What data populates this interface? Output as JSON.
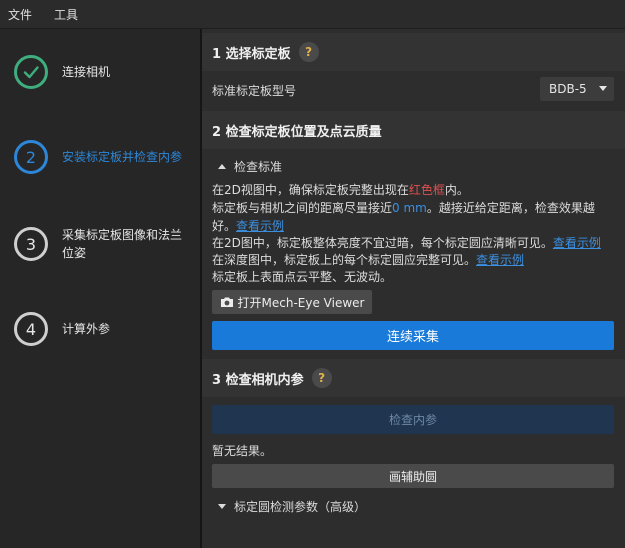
{
  "menu": {
    "file": "文件",
    "tools": "工具"
  },
  "steps": [
    {
      "label": "连接相机",
      "state": "done"
    },
    {
      "number": "2",
      "label": "安装标定板并检查内参",
      "state": "active"
    },
    {
      "number": "3",
      "label": "采集标定板图像和法兰位姿",
      "state": "pending"
    },
    {
      "number": "4",
      "label": "计算外参",
      "state": "pending"
    }
  ],
  "section1": {
    "title": "1 选择标定板",
    "help": "?",
    "board_label": "标准标定板型号",
    "board_value": "BDB-5"
  },
  "section2": {
    "title": "2 检查标定板位置及点云质量",
    "criteria_toggle": "检查标准",
    "line1_a": "在2D视图中，确保标定板完整出现在",
    "line1_red": "红色框",
    "line1_b": "内。",
    "line2_a": "标定板与相机之间的距离尽量接近",
    "line2_blue": "0 mm",
    "line2_b": "。越接近给定距离，检查效果越",
    "line3_a": "好。",
    "line3_link": "查看示例",
    "line4_a": "在2D图中，标定板整体亮度不宜过暗，每个标定圆应清晰可见。",
    "line4_link": "查看示例",
    "line5_a": "在深度图中，标定板上的每个标定圆应完整可见。",
    "line5_link": "查看示例",
    "line6": "标定板上表面点云平整、无波动。",
    "open_viewer": "打开Mech-Eye Viewer",
    "continuous_capture": "连续采集"
  },
  "section3": {
    "title": "3 检查相机内参",
    "help": "?",
    "check_button": "检查内参",
    "result": "暂无结果。",
    "draw_circle": "画辅助圆",
    "advanced_toggle": "标定圆检测参数（高级）"
  },
  "colors": {
    "accent": "#1a7ad9",
    "done": "#3fae7e",
    "active": "#2d87d8",
    "warning_red": "#e05050"
  }
}
